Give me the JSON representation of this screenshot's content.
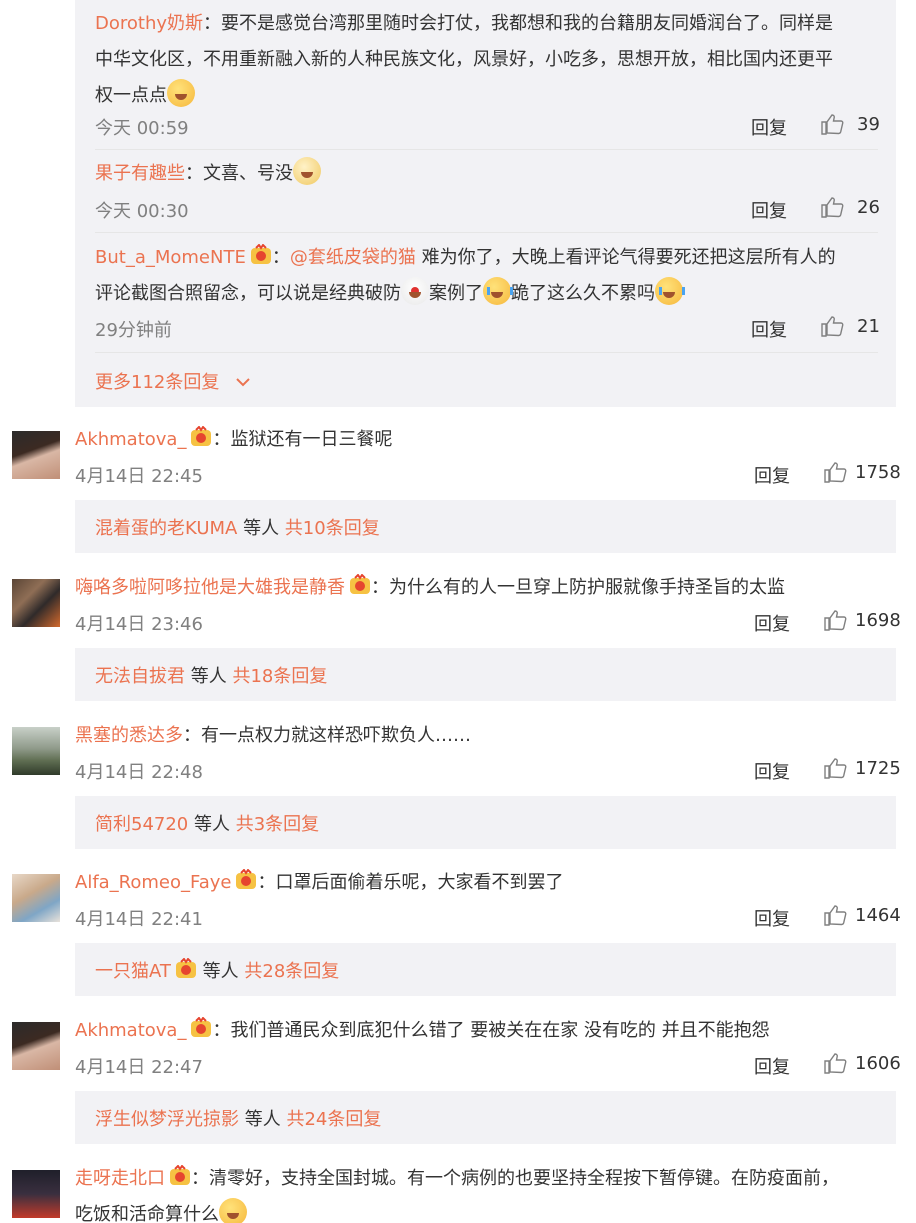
{
  "sub_comments": [
    {
      "user": "Dorothy奶斯",
      "text_lines": [
        "：要不是感觉台湾那里随时会打仗，我都想和我的台籍朋友同婚润台了。同样是",
        "中华文化区，不用重新融入新的人种民族文化，风景好，小吃多，思想开放，相比国内还更平",
        "权一点点"
      ],
      "time": "今天 00:59",
      "reply_label": "回复",
      "likes": "39"
    },
    {
      "user": "果子有趣些",
      "text_lines": [
        "：文喜、号没"
      ],
      "time": "今天 00:30",
      "reply_label": "回复",
      "likes": "26"
    },
    {
      "user": "But_a_MomeNTE",
      "mention": "@套纸皮袋的猫",
      "text_lines": [
        " 难为你了，大晚上看评论气得要死还把这层所有人的",
        "评论截图合照留念，可以说是经典破防",
        "案例了",
        "跪了这么久不累吗"
      ],
      "time": "29分钟前",
      "reply_label": "回复",
      "likes": "21"
    }
  ],
  "more_replies": "更多112条回复",
  "comments": [
    {
      "user": "Akhmatova_",
      "text": "：监狱还有一日三餐呢",
      "time": "4月14日 22:45",
      "reply_label": "回复",
      "likes": "1758",
      "summary": {
        "who": "混着蛋的老KUMA",
        "others": "等人",
        "count": "共10条回复"
      }
    },
    {
      "user": "嗨咯多啦阿哆拉他是大雄我是静香",
      "text": "：为什么有的人一旦穿上防护服就像手持圣旨的太监",
      "time": "4月14日 23:46",
      "reply_label": "回复",
      "likes": "1698",
      "summary": {
        "who": "无法自拔君",
        "others": "等人",
        "count": "共18条回复"
      }
    },
    {
      "user": "黑塞的悉达多",
      "text": "：有一点权力就这样恐吓欺负人……",
      "time": "4月14日 22:48",
      "reply_label": "回复",
      "likes": "1725",
      "summary": {
        "who": "简利54720",
        "others": "等人",
        "count": "共3条回复"
      }
    },
    {
      "user": "Alfa_Romeo_Faye",
      "text": "：口罩后面偷着乐呢，大家看不到罢了",
      "time": "4月14日 22:41",
      "reply_label": "回复",
      "likes": "1464",
      "summary": {
        "who": "一只猫AT",
        "others": "等人",
        "count": "共28条回复"
      }
    },
    {
      "user": "Akhmatova_",
      "text": "：我们普通民众到底犯什么错了 要被关在在家 没有吃的 并且不能抱怨",
      "time": "4月14日 22:47",
      "reply_label": "回复",
      "likes": "1606",
      "summary": {
        "who": "浮生似梦浮光掠影",
        "others": "等人",
        "count": "共24条回复"
      }
    },
    {
      "user": "走呀走北口",
      "text_lines": [
        "：清零好，支持全国封城。有一个病例的也要坚持全程按下暂停键。在防疫面前，",
        "吃饭和活命算什么"
      ]
    }
  ],
  "colors": {
    "name": "#eb7350",
    "panel": "#f2f2f5",
    "text": "#333333",
    "meta": "#808080"
  },
  "icons": {
    "like": "thumbs-up-icon",
    "badge": "vip-badge-icon",
    "chevron": "chevron-down-icon"
  }
}
